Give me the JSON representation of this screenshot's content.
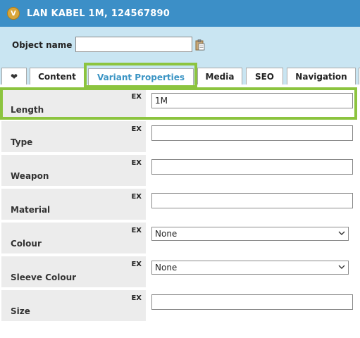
{
  "window": {
    "title": "LAN KABEL 1M, 124567890",
    "icon": "app-logo-icon"
  },
  "header": {
    "object_name_label": "Object name",
    "object_name_value": "",
    "clipboard_icon": "clipboard-icon"
  },
  "tabs": [
    {
      "label": "",
      "icon": "heart-icon",
      "glyph": "❤"
    },
    {
      "label": "Content"
    },
    {
      "label": "Variant Properties",
      "active": true
    },
    {
      "label": "Media"
    },
    {
      "label": "SEO"
    },
    {
      "label": "Navigation"
    }
  ],
  "properties": [
    {
      "label": "Length",
      "badge": "EX",
      "kind": "text",
      "value": "1M"
    },
    {
      "label": "Type",
      "badge": "EX",
      "kind": "text",
      "value": ""
    },
    {
      "label": "Weapon",
      "badge": "EX",
      "kind": "text",
      "value": ""
    },
    {
      "label": "Material",
      "badge": "EX",
      "kind": "text",
      "value": ""
    },
    {
      "label": "Colour",
      "badge": "EX",
      "kind": "select",
      "value": "None"
    },
    {
      "label": "Sleeve Colour",
      "badge": "EX",
      "kind": "select",
      "value": "None"
    },
    {
      "label": "Size",
      "badge": "EX",
      "kind": "text",
      "value": ""
    }
  ],
  "colors": {
    "titlebar": "#3c8fc7",
    "header_bg": "#c9e5f2",
    "highlight": "#8cc43f",
    "active_tab_text": "#3a94c4"
  }
}
